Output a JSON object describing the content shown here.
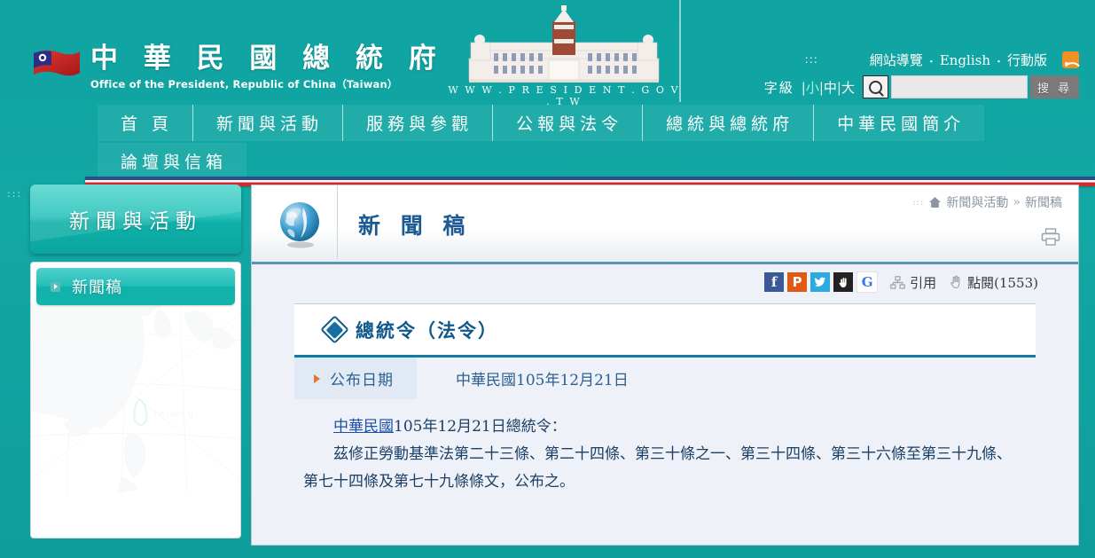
{
  "site": {
    "title_cn": "中 華 民 國 總 統 府",
    "title_en": "Office of the President, Republic of China（Taiwan）",
    "building_url": "W W W . P R E S I D E N T . G O V . T W",
    "flag_icon": "roc-flag-icon",
    "building_icon": "presidential-office-building-icon"
  },
  "utility": {
    "accessibility_mark": ":::",
    "links": [
      {
        "label": "網站導覽"
      },
      {
        "label": "English"
      },
      {
        "label": "行動版"
      }
    ],
    "separator": "・",
    "rss_icon": "rss-icon",
    "fontsize_label": "字級",
    "fontsize_options": [
      {
        "label": "小",
        "selected": true
      },
      {
        "label": "中",
        "selected": false
      },
      {
        "label": "大",
        "selected": false
      }
    ],
    "fontsize_divider": "|",
    "search_icon": "search-icon",
    "search_value": "",
    "search_placeholder": "",
    "search_button": "搜 尋"
  },
  "nav": {
    "row1": [
      {
        "label": "首 頁"
      },
      {
        "label": "新聞與活動"
      },
      {
        "label": "服務與參觀"
      },
      {
        "label": "公報與法令"
      },
      {
        "label": "總統與總統府"
      },
      {
        "label": "中華民國簡介"
      }
    ],
    "row2": [
      {
        "label": "論壇與信箱"
      }
    ]
  },
  "sidebar": {
    "accessibility_mark": ":::",
    "heading": "新聞與活動",
    "items": [
      {
        "label": "新聞稿",
        "arrow_icon": "arrow-right-icon",
        "active": true
      }
    ],
    "map_icon": "east-asia-map-icon"
  },
  "content": {
    "globe_icon": "news-globe-icon",
    "title": "新 聞 稿",
    "breadcrumb": {
      "dots": ":::",
      "home_icon": "home-icon",
      "items": [
        "新聞與活動",
        "新聞稿"
      ],
      "separator": "»"
    },
    "print_icon": "printer-icon",
    "share": {
      "icons": [
        {
          "name": "facebook-icon",
          "glyph": "f",
          "class": "fb"
        },
        {
          "name": "plurk-icon",
          "glyph": "P",
          "class": "plurk"
        },
        {
          "name": "twitter-icon",
          "glyph": "❈",
          "class": "tw"
        },
        {
          "name": "funp-icon",
          "glyph": "✋",
          "class": "funp"
        },
        {
          "name": "google-plus-icon",
          "glyph": "G",
          "class": "gp"
        }
      ],
      "cite_icon": "sitemap-icon",
      "cite_label": "引用",
      "views_icon": "hand-pointer-icon",
      "views_label": "點閱(1553)"
    },
    "article": {
      "diamond_icon": "diamond-bullet-icon",
      "heading": "總統令（法令）",
      "meta_arrow_icon": "triangle-right-icon",
      "meta_label": "公布日期",
      "meta_value": "中華民國105年12月21日",
      "body_line1_link": "中華民國",
      "body_line1_rest": "105年12月21日總統令：",
      "body_line2": "茲修正勞動基準法第二十三條、第二十四條、第三十條之一、第三十四條、第三十六條至第三十九條、第七十四條及第七十九條條文，公布之。"
    }
  },
  "colors": {
    "brand_teal": "#10a2a0",
    "accent_blue": "#1d5a93",
    "flag_blue": "#2b4f8e",
    "flag_red": "#d32a2a",
    "orange": "#e8762a"
  }
}
